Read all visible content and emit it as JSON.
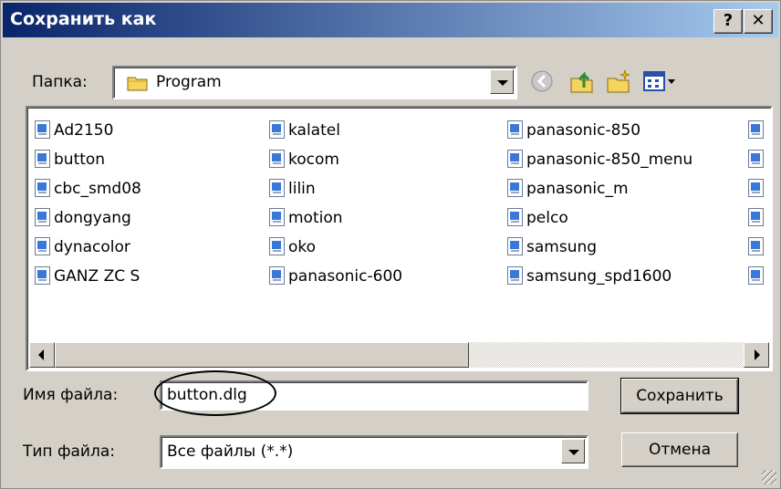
{
  "dialog": {
    "title": "Сохранить как",
    "help_label": "?",
    "close_label": "✕"
  },
  "toolbar": {
    "folder_label": "Папка:",
    "folder_value": "Program",
    "icons": [
      "back-icon",
      "up-folder-icon",
      "new-folder-icon",
      "view-menu-icon"
    ]
  },
  "files": {
    "col1": [
      "Ad2150",
      "button",
      "cbc_smd08",
      "dongyang",
      "dynacolor",
      "GANZ ZC S"
    ],
    "col2": [
      "kalatel",
      "kocom",
      "lilin",
      "motion",
      "oko",
      "panasonic-600"
    ],
    "col3": [
      "panasonic-850",
      "panasonic-850_menu",
      "panasonic_m",
      "pelco",
      "samsung",
      "samsung_spd1600"
    ]
  },
  "form": {
    "filename_label": "Имя файла:",
    "filename_value": "button.dlg",
    "filetype_label": "Тип файла:",
    "filetype_value": "Все файлы (*.*)"
  },
  "buttons": {
    "save_label": "Сохранить",
    "cancel_label": "Отмена"
  },
  "colors": {
    "title_start": "#0a246a",
    "title_end": "#a6caf0",
    "face": "#d4d0c8"
  }
}
